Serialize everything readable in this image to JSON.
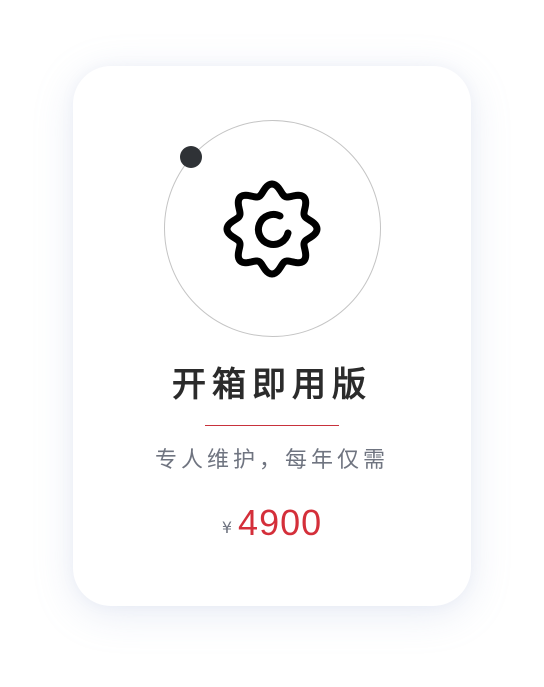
{
  "plan": {
    "icon": "gear-icon",
    "title": "开箱即用版",
    "subtitle": "专人维护，每年仅需",
    "currency_symbol": "¥",
    "price": "4900"
  },
  "colors": {
    "accent": "#d42f3a",
    "text_dark": "#2b2b2b",
    "text_muted": "#6f7480",
    "orbit_dot": "#2f3236"
  }
}
